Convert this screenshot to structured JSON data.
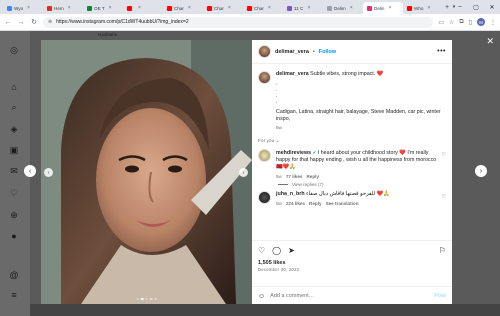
{
  "browser": {
    "tabs": [
      {
        "label": "Wyo",
        "color": "#4285f4",
        "active": false
      },
      {
        "label": "Hem",
        "color": "#d93025",
        "active": false
      },
      {
        "label": "OE T",
        "color": "#188038",
        "active": false
      },
      {
        "label": "",
        "color": "#ff0000",
        "active": false
      },
      {
        "label": "Char",
        "color": "#ff0000",
        "active": false
      },
      {
        "label": "Char",
        "color": "#ff0000",
        "active": false
      },
      {
        "label": "Char",
        "color": "#ff0000",
        "active": false
      },
      {
        "label": "11 C",
        "color": "#7e57c2",
        "active": false
      },
      {
        "label": "Delim",
        "color": "#9aa0a6",
        "active": false
      },
      {
        "label": "Delin",
        "color": "#e1306c",
        "active": true
      },
      {
        "label": "Who",
        "color": "#ff0000",
        "active": false
      }
    ],
    "url": "https://www.instagram.com/p/C1dWT4uubbU/?img_index=2",
    "profile_initial": "M"
  },
  "behind_label": "Hashtahs",
  "post": {
    "username": "delimar_vera",
    "follow_label": "Follow",
    "caption": {
      "username": "delimar_vera",
      "text": "Subtle vibes, strong impact. ❤️",
      "bullets": [
        ".",
        ".",
        ".",
        "."
      ],
      "tags": "Cadigan, Latina, straight hair, balayage, Steve Madden, car pic, winter inspo,",
      "time": "5w"
    },
    "for_you_label": "For you",
    "comments": [
      {
        "username": "mehdireviews",
        "verified": true,
        "text": "I heard about your childhood story ❤️ I'm really happy for that happy ending , wish u all the happiness from morocco 🇲🇦❤️🙏",
        "time": "5w",
        "likes": "77 likes",
        "reply": "Reply",
        "view_replies": "View replies (7)"
      },
      {
        "username": "juha_n_brh",
        "verified": false,
        "text": "للفرحو قصتها فاقاش ديال صفاء ❤️🙏",
        "time": "5w",
        "likes": "224 likes",
        "reply": "Reply",
        "see_translation": "See translation"
      }
    ],
    "likes_count": "1,505 likes",
    "date": "December 30, 2023",
    "add_comment_placeholder": "Add a comment…",
    "post_label": "Post"
  },
  "photo": {
    "active_dot": 1,
    "dot_count": 5
  }
}
